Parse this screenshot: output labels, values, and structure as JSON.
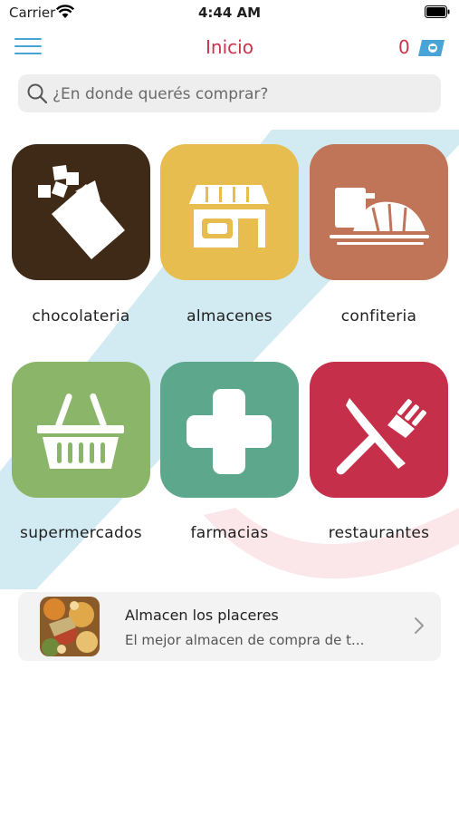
{
  "status_bar": {
    "carrier": "Carrier",
    "time": "4:44 AM"
  },
  "nav": {
    "title": "Inicio",
    "cart_count": "0"
  },
  "search": {
    "placeholder": "¿En donde querés comprar?"
  },
  "categories": [
    {
      "label": "chocolateria",
      "color": "#3f2a17",
      "icon": "chocolate-bar-icon"
    },
    {
      "label": "almacenes",
      "color": "#e8bd4f",
      "icon": "storefront-icon"
    },
    {
      "label": "confiteria",
      "color": "#c07458",
      "icon": "coffee-croissant-icon"
    },
    {
      "label": "supermercados",
      "color": "#8bb568",
      "icon": "shopping-basket-icon"
    },
    {
      "label": "farmacias",
      "color": "#5da88d",
      "icon": "medical-cross-icon"
    },
    {
      "label": "restaurantes",
      "color": "#c52f4a",
      "icon": "knife-fork-icon"
    }
  ],
  "featured_store": {
    "name": "Almacen los placeres",
    "description": "El mejor almacen de compra de t..."
  },
  "colors": {
    "accent": "#c8354d",
    "menu": "#4aa3d6"
  }
}
